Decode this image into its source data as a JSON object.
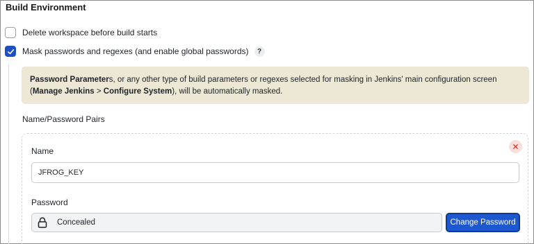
{
  "section": {
    "title": "Build Environment"
  },
  "options": [
    {
      "label": "Delete workspace before build starts",
      "checked": false
    },
    {
      "label": "Mask passwords and regexes (and enable global passwords)",
      "checked": true,
      "help": "?"
    }
  ],
  "notice": {
    "part1_bold": "Password Parameter",
    "part2": "s, or any other type of build parameters or regexes selected for masking in Jenkins' main configuration screen (",
    "part3_bold": "Manage Jenkins",
    "part4": " > ",
    "part5_bold": "Configure System",
    "part6": "), will be automatically masked."
  },
  "pairs": {
    "label": "Name/Password Pairs",
    "name_label": "Name",
    "name_value": "JFROG_KEY",
    "password_label": "Password",
    "password_value": "Concealed",
    "change_button": "Change Password"
  },
  "icons": {
    "close": "close-icon",
    "lock": "lock-icon",
    "check": "check-icon",
    "help": "help-icon"
  },
  "colors": {
    "accent": "#1d58d1",
    "notice_bg": "#ece8d5",
    "close_bg": "#f9dede",
    "close_fg": "#c0392b"
  }
}
